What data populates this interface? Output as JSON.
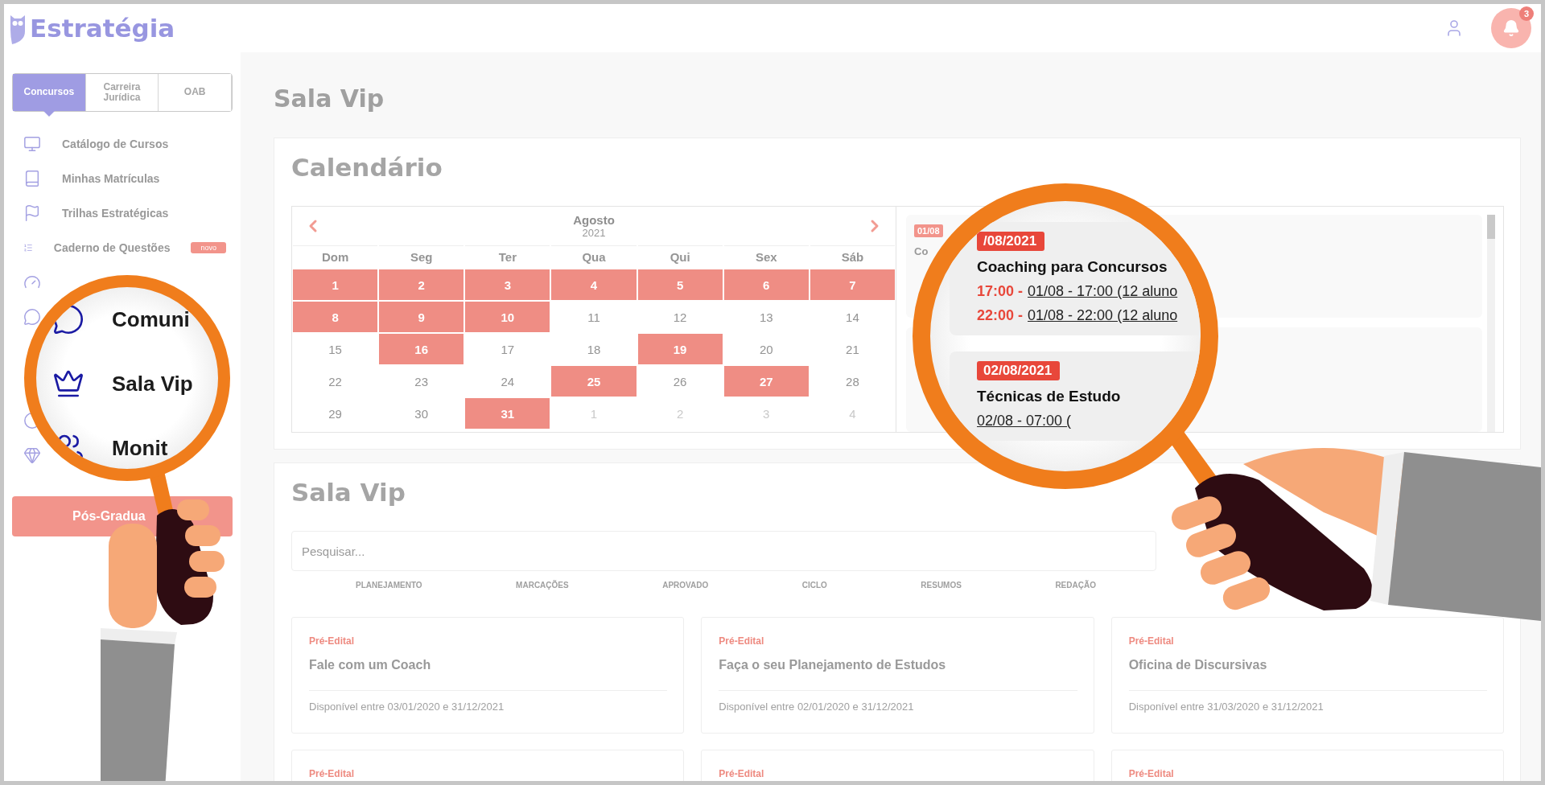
{
  "logo": {
    "text": "Estratégia"
  },
  "header": {
    "notification_count": "3"
  },
  "segments": [
    {
      "label": "Concursos",
      "selected": true
    },
    {
      "label": "Carreira Jurídica",
      "selected": false
    },
    {
      "label": "OAB",
      "selected": false
    }
  ],
  "nav": [
    {
      "kind": "monitor",
      "label": "Catálogo de Cursos"
    },
    {
      "kind": "book",
      "label": "Minhas Matrículas"
    },
    {
      "kind": "flag",
      "label": "Trilhas Estratégicas"
    },
    {
      "kind": "list",
      "label": "Caderno de Questões",
      "badge": "novo"
    },
    {
      "kind": "gauge"
    },
    {
      "kind": "chat"
    }
  ],
  "nav_lower": [
    {
      "kind": "circle"
    },
    {
      "kind": "diamond"
    }
  ],
  "sidebar_button": {
    "label": "Pós-Gradua"
  },
  "page_title": "Sala Vip",
  "calendar": {
    "title": "Calendário",
    "month": "Agosto",
    "year": "2021",
    "weekdays": [
      "Dom",
      "Seg",
      "Ter",
      "Qua",
      "Qui",
      "Sex",
      "Sáb"
    ],
    "days": [
      {
        "day": "1",
        "marked": true,
        "outside": false
      },
      {
        "day": "2",
        "marked": true,
        "outside": false
      },
      {
        "day": "3",
        "marked": true,
        "outside": false
      },
      {
        "day": "4",
        "marked": true,
        "outside": false
      },
      {
        "day": "5",
        "marked": true,
        "outside": false
      },
      {
        "day": "6",
        "marked": true,
        "outside": false
      },
      {
        "day": "7",
        "marked": true,
        "outside": false
      },
      {
        "day": "8",
        "marked": true,
        "outside": false
      },
      {
        "day": "9",
        "marked": true,
        "outside": false
      },
      {
        "day": "10",
        "marked": true,
        "outside": false
      },
      {
        "day": "11",
        "marked": false,
        "outside": false
      },
      {
        "day": "12",
        "marked": false,
        "outside": false
      },
      {
        "day": "13",
        "marked": false,
        "outside": false
      },
      {
        "day": "14",
        "marked": false,
        "outside": false
      },
      {
        "day": "15",
        "marked": false,
        "outside": false
      },
      {
        "day": "16",
        "marked": true,
        "outside": false
      },
      {
        "day": "17",
        "marked": false,
        "outside": false
      },
      {
        "day": "18",
        "marked": false,
        "outside": false
      },
      {
        "day": "19",
        "marked": true,
        "outside": false
      },
      {
        "day": "20",
        "marked": false,
        "outside": false
      },
      {
        "day": "21",
        "marked": false,
        "outside": false
      },
      {
        "day": "22",
        "marked": false,
        "outside": false
      },
      {
        "day": "23",
        "marked": false,
        "outside": false
      },
      {
        "day": "24",
        "marked": false,
        "outside": false
      },
      {
        "day": "25",
        "marked": true,
        "outside": false
      },
      {
        "day": "26",
        "marked": false,
        "outside": false
      },
      {
        "day": "27",
        "marked": true,
        "outside": false
      },
      {
        "day": "28",
        "marked": false,
        "outside": false
      },
      {
        "day": "29",
        "marked": false,
        "outside": false
      },
      {
        "day": "30",
        "marked": false,
        "outside": false
      },
      {
        "day": "31",
        "marked": true,
        "outside": false
      },
      {
        "day": "1",
        "marked": false,
        "outside": true
      },
      {
        "day": "2",
        "marked": false,
        "outside": true
      },
      {
        "day": "3",
        "marked": false,
        "outside": true
      },
      {
        "day": "4",
        "marked": false,
        "outside": true
      }
    ],
    "events": [
      {
        "date": "01/08",
        "title": "Co"
      }
    ]
  },
  "lens_left": {
    "items": [
      {
        "kind": "chat",
        "label": "Comuni"
      },
      {
        "kind": "crown",
        "label": "Sala Vip"
      },
      {
        "kind": "people",
        "label": "Monit"
      }
    ]
  },
  "lens_right": {
    "events": [
      {
        "date": "/08/2021",
        "title": "Coaching para Concursos",
        "sessions": [
          {
            "time": "17:00 -",
            "link": "01/08 - 17:00 (12 aluno"
          },
          {
            "time": "22:00 -",
            "link": "01/08 - 22:00 (12 aluno"
          }
        ]
      },
      {
        "date": "02/08/2021",
        "title": "Técnicas de Estudo",
        "sessions": [
          {
            "link": "02/08 - 07:00 ("
          }
        ]
      }
    ]
  },
  "sala_vip": {
    "title": "Sala Vip",
    "search": {
      "placeholder": "Pesquisar..."
    },
    "filters": [
      "PLANEJAMENTO",
      "MARCAÇÕES",
      "APROVADO",
      "CICLO",
      "RESUMOS",
      "REDAÇÃO"
    ],
    "cards": [
      {
        "tag": "Pré-Edital",
        "title": "Fale com um Coach",
        "availability": "Disponível entre 03/01/2020 e 31/12/2021"
      },
      {
        "tag": "Pré-Edital",
        "title": "Faça o seu Planejamento de Estudos",
        "availability": "Disponível entre 02/01/2020 e 31/12/2021"
      },
      {
        "tag": "Pré-Edital",
        "title": "Oficina de Discursivas",
        "availability": "Disponível entre 31/03/2020 e 31/12/2021"
      },
      {
        "tag": "Pré-Edital"
      },
      {
        "tag": "Pré-Edital"
      },
      {
        "tag": "Pré-Edital"
      }
    ]
  }
}
